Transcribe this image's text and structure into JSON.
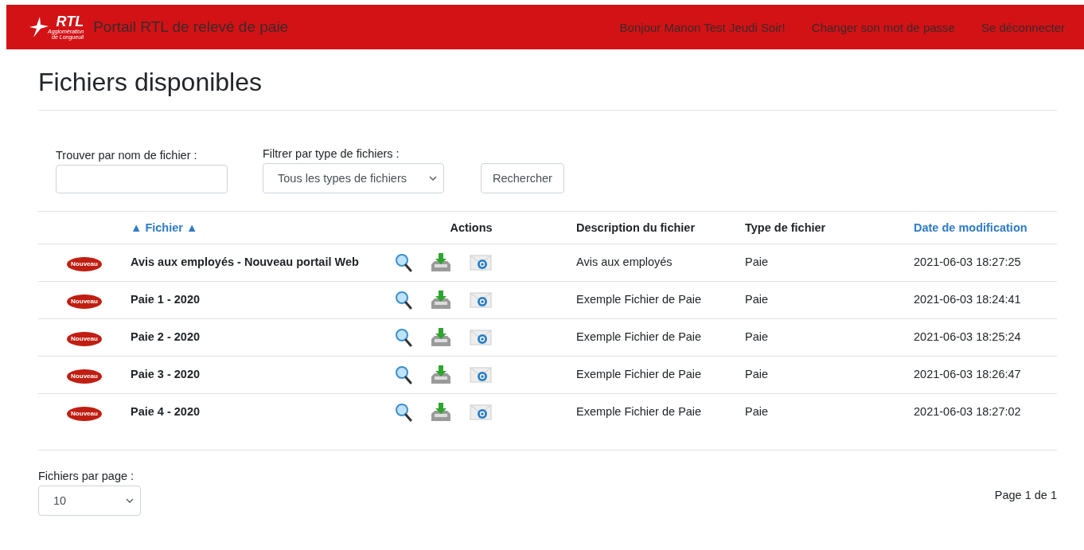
{
  "header": {
    "logo": {
      "mark": "RTL",
      "sub_1": "Agglomération",
      "sub_2": "de Longueuil"
    },
    "title": "Portail RTL de relevé de paie",
    "links": [
      "Bonjour Manon Test Jeudi Soir!",
      "Changer son mot de passe",
      "Se déconnecter"
    ]
  },
  "page_title": "Fichiers disponibles",
  "filters": {
    "name_label": "Trouver par nom de fichier :",
    "type_label": "Filtrer par type de fichiers :",
    "type_value": "Tous les types de fichiers",
    "search_button": "Rechercher"
  },
  "table": {
    "columns": [
      {
        "label": "▲ Fichier ▲",
        "kind": "link"
      },
      {
        "label": "Actions",
        "kind": "plain"
      },
      {
        "label": "Description du fichier",
        "kind": "plain"
      },
      {
        "label": "Type de fichier",
        "kind": "plain"
      },
      {
        "label": "Date de modification",
        "kind": "link"
      }
    ],
    "rows": [
      {
        "badge": "Nouveau",
        "file": "Avis aux employés - Nouveau portail Web",
        "description": "Avis aux employés",
        "type": "Paie",
        "date": "2021-06-03 18:27:25"
      },
      {
        "badge": "Nouveau",
        "file": "Paie 1 - 2020",
        "description": "Exemple Fichier de Paie",
        "type": "Paie",
        "date": "2021-06-03 18:24:41"
      },
      {
        "badge": "Nouveau",
        "file": "Paie 2 - 2020",
        "description": "Exemple Fichier de Paie",
        "type": "Paie",
        "date": "2021-06-03 18:25:24"
      },
      {
        "badge": "Nouveau",
        "file": "Paie 3 - 2020",
        "description": "Exemple Fichier de Paie",
        "type": "Paie",
        "date": "2021-06-03 18:26:47"
      },
      {
        "badge": "Nouveau",
        "file": "Paie 4 - 2020",
        "description": "Exemple Fichier de Paie",
        "type": "Paie",
        "date": "2021-06-03 18:27:02"
      }
    ]
  },
  "footer": {
    "per_page_label": "Fichiers par page :",
    "per_page_value": "10",
    "pagination": "Page 1 de 1"
  }
}
